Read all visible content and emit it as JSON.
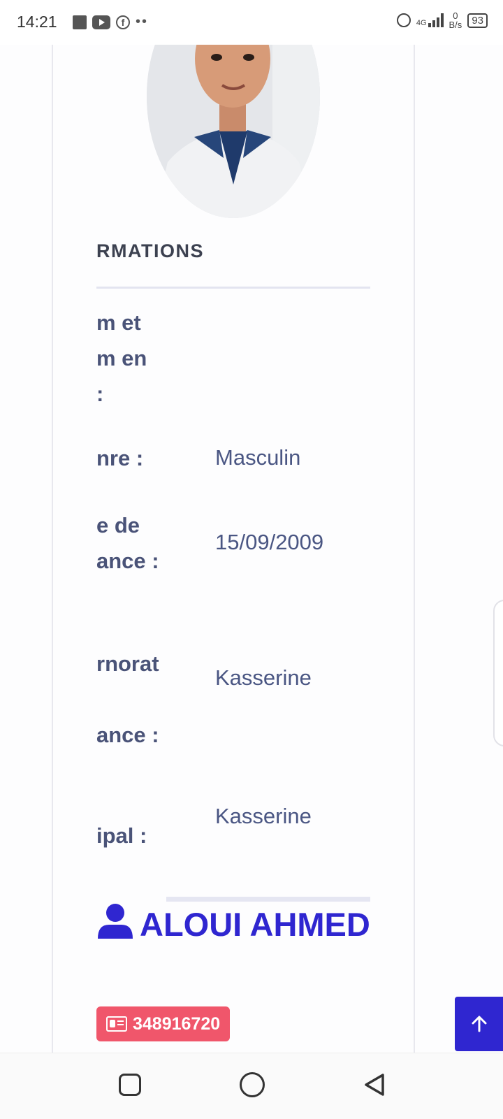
{
  "status_bar": {
    "time": "14:21",
    "network": "4G",
    "speed_value": "0",
    "speed_unit": "B/s",
    "battery": "93",
    "icons": [
      "notification-square-icon",
      "youtube-icon",
      "facebook-icon",
      "more-dots-icon",
      "alarm-icon",
      "signal-icon",
      "battery-icon"
    ]
  },
  "profile": {
    "section_title": "RMATIONS",
    "fields": [
      {
        "label_lines": [
          "m et",
          "m en",
          ":"
        ],
        "value": ""
      },
      {
        "label_lines": [
          "nre :"
        ],
        "value": "Masculin"
      },
      {
        "label_lines": [
          "e de",
          "ance :"
        ],
        "value": "15/09/2009"
      },
      {
        "label_lines": [
          "rnorat",
          "",
          "ance :"
        ],
        "value": "Kasserine"
      },
      {
        "label_lines": [
          "ipal :"
        ],
        "value": "Kasserine"
      }
    ],
    "full_name": "ALOUI AHMED",
    "id_number": "348916720"
  },
  "colors": {
    "accent": "#2f26d0",
    "badge": "#f0566b",
    "label_text": "#4a5378",
    "value_text": "#4a5683"
  }
}
